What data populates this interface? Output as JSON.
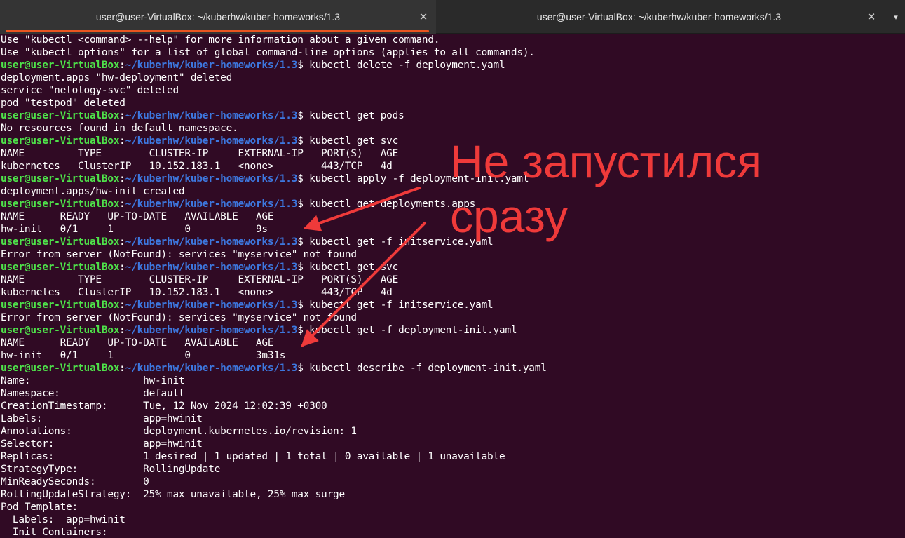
{
  "tabs": [
    {
      "title": "user@user-VirtualBox: ~/kuberhw/kuber-homeworks/1.3",
      "close_glyph": "✕",
      "active": true
    },
    {
      "title": "user@user-VirtualBox: ~/kuberhw/kuber-homeworks/1.3",
      "close_glyph": "✕",
      "active": false
    }
  ],
  "tab_menu_glyph": "▾",
  "prompt": {
    "user": "user@user-VirtualBox",
    "colon": ":",
    "path": "~/kuberhw/kuber-homeworks/1.3",
    "dollar": "$ "
  },
  "terminal_lines": [
    {
      "text": "Use \"kubectl <command> --help\" for more information about a given command."
    },
    {
      "text": "Use \"kubectl options\" for a list of global command-line options (applies to all commands)."
    },
    {
      "command": "kubectl delete -f deployment.yaml"
    },
    {
      "text": "deployment.apps \"hw-deployment\" deleted"
    },
    {
      "text": "service \"netology-svc\" deleted"
    },
    {
      "text": "pod \"testpod\" deleted"
    },
    {
      "command": "kubectl get pods"
    },
    {
      "text": "No resources found in default namespace."
    },
    {
      "command": "kubectl get svc"
    },
    {
      "text": "NAME         TYPE        CLUSTER-IP     EXTERNAL-IP   PORT(S)   AGE"
    },
    {
      "text": "kubernetes   ClusterIP   10.152.183.1   <none>        443/TCP   4d"
    },
    {
      "command": "kubectl apply -f deployment-init.yaml"
    },
    {
      "text": "deployment.apps/hw-init created"
    },
    {
      "command": "kubectl get deployments.apps"
    },
    {
      "text": "NAME      READY   UP-TO-DATE   AVAILABLE   AGE"
    },
    {
      "text": "hw-init   0/1     1            0           9s"
    },
    {
      "command": "kubectl get -f initservice.yaml"
    },
    {
      "text": "Error from server (NotFound): services \"myservice\" not found"
    },
    {
      "command": "kubectl get svc"
    },
    {
      "text": "NAME         TYPE        CLUSTER-IP     EXTERNAL-IP   PORT(S)   AGE"
    },
    {
      "text": "kubernetes   ClusterIP   10.152.183.1   <none>        443/TCP   4d"
    },
    {
      "command": "kubectl get -f initservice.yaml"
    },
    {
      "text": "Error from server (NotFound): services \"myservice\" not found"
    },
    {
      "command": "kubectl get -f deployment-init.yaml"
    },
    {
      "text": "NAME      READY   UP-TO-DATE   AVAILABLE   AGE"
    },
    {
      "text": "hw-init   0/1     1            0           3m31s"
    },
    {
      "command": "kubectl describe -f deployment-init.yaml"
    },
    {
      "text": "Name:                   hw-init"
    },
    {
      "text": "Namespace:              default"
    },
    {
      "text": "CreationTimestamp:      Tue, 12 Nov 2024 12:02:39 +0300"
    },
    {
      "text": "Labels:                 app=hwinit"
    },
    {
      "text": "Annotations:            deployment.kubernetes.io/revision: 1"
    },
    {
      "text": "Selector:               app=hwinit"
    },
    {
      "text": "Replicas:               1 desired | 1 updated | 1 total | 0 available | 1 unavailable"
    },
    {
      "text": "StrategyType:           RollingUpdate"
    },
    {
      "text": "MinReadySeconds:        0"
    },
    {
      "text": "RollingUpdateStrategy:  25% max unavailable, 25% max surge"
    },
    {
      "text": "Pod Template:"
    },
    {
      "text": "  Labels:  app=hwinit"
    },
    {
      "text": "  Init Containers:"
    }
  ],
  "annotation": {
    "line1": "Не запустился",
    "line2": "сразу",
    "color": "#ef3a3a"
  },
  "colors": {
    "background": "#300a24",
    "prompt_user": "#4ee34a",
    "prompt_path": "#3d78e0",
    "tab_accent": "#e95420"
  }
}
